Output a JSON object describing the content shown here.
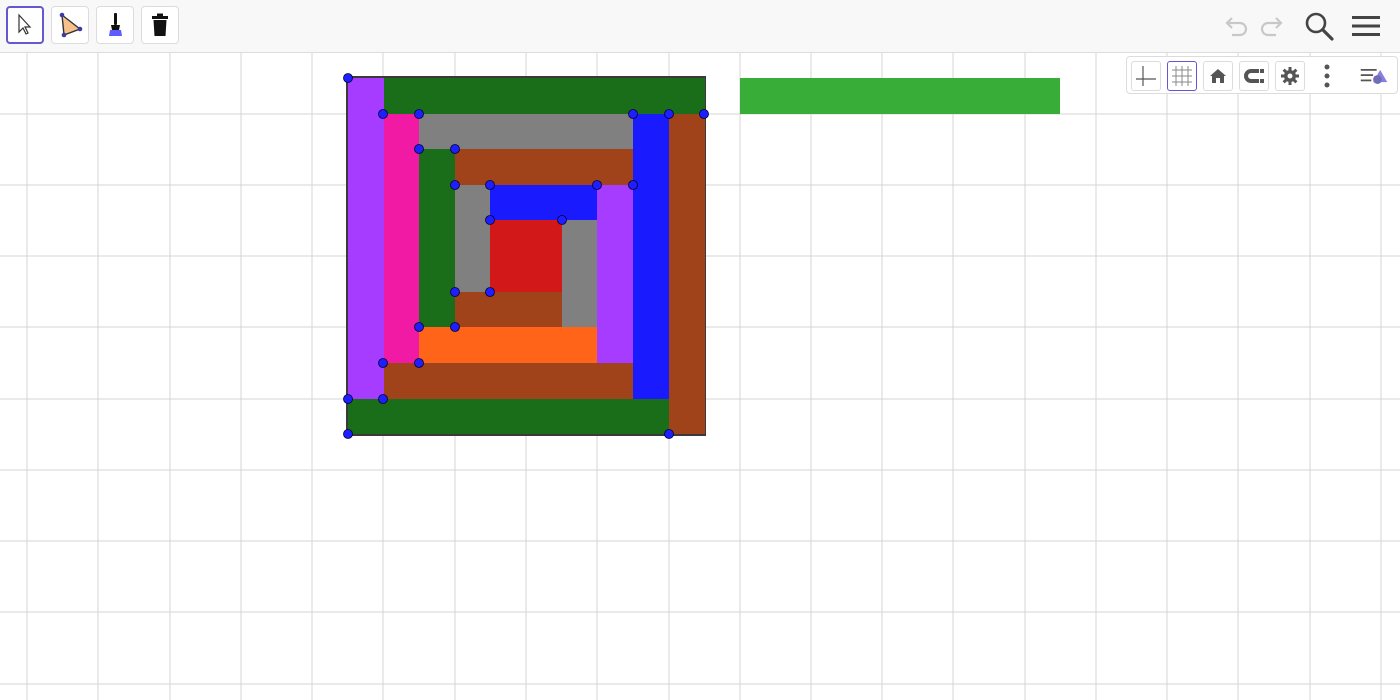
{
  "toolbar": {
    "tools": [
      {
        "name": "move-tool",
        "icon": "arrow-cursor-icon",
        "active": true
      },
      {
        "name": "polygon-tool",
        "icon": "polygon-icon",
        "active": false
      },
      {
        "name": "style-painter-tool",
        "icon": "paintbrush-icon",
        "active": false
      },
      {
        "name": "delete-tool",
        "icon": "trash-icon",
        "active": false
      }
    ],
    "right": [
      "undo-icon",
      "redo-icon",
      "search-icon",
      "menu-icon"
    ]
  },
  "style_bar": {
    "buttons": [
      "axes-icon",
      "grid-icon",
      "home-icon",
      "magnet-icon",
      "gear-icon",
      "more-vertical-icon",
      "style-bar-toggle-icon"
    ]
  },
  "colors": {
    "accent": "#6557d2",
    "grid": "#d4d4d4",
    "point": "#1e1eff",
    "dark_green": "#1a6e1a",
    "light_green": "#38ad38",
    "purple": "#a63cff",
    "magenta": "#f01aa4",
    "gray": "#808080",
    "brown": "#a0421a",
    "blue": "#1a1aff",
    "orange": "#ff6418",
    "red": "#d21818"
  }
}
